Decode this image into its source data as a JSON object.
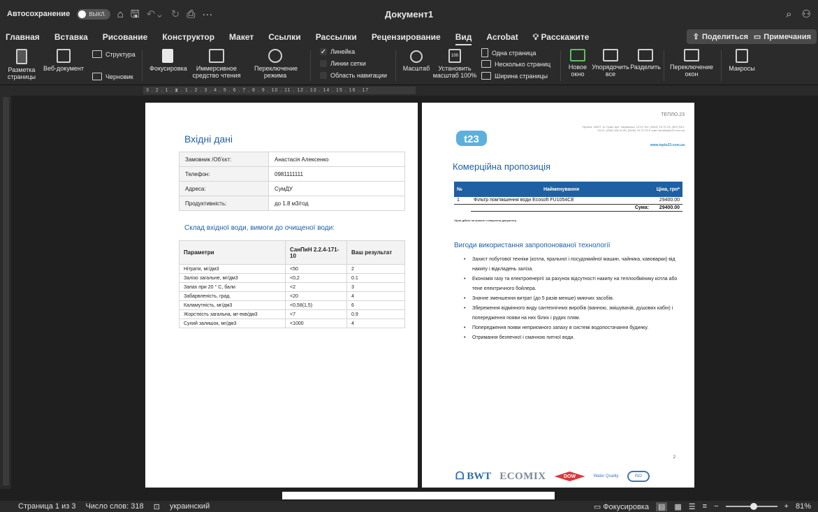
{
  "window": {
    "autosave_label": "Автосохранение",
    "autosave_state": "ВЫКЛ.",
    "doc_title": "Документ1"
  },
  "tabs": [
    "Главная",
    "Вставка",
    "Рисование",
    "Конструктор",
    "Макет",
    "Ссылки",
    "Рассылки",
    "Рецензирование",
    "Вид",
    "Acrobat"
  ],
  "active_tab": "Вид",
  "tell_me": "Расскажите",
  "share_label": "Поделиться",
  "comments_label": "Примечания",
  "ribbon": {
    "print_layout": "Разметка страницы",
    "web_layout": "Веб-документ",
    "outline": "Структура",
    "draft": "Черновик",
    "focus": "Фокусировка",
    "immersive": "Иммерсивное средство чтения",
    "switch_mode": "Переключение режима",
    "ruler": "Линейка",
    "gridlines": "Линии сетки",
    "nav_pane": "Область навигации",
    "zoom": "Масштаб",
    "zoom100": "Установить масштаб 100%",
    "one_page": "Одна страница",
    "multi_page": "Несколько страниц",
    "page_width": "Ширина страницы",
    "new_window": "Новое окно",
    "arrange_all": "Упорядочить все",
    "split": "Разделить",
    "switch_windows": "Переключение окон",
    "macros": "Макросы",
    "zoom100_badge": "100"
  },
  "ruler_text": "3 . 2 . 1 . ⧗ . 1 . 2 . 3 . 4 . 5 . 6 . 7 . 8 . 9 . 10 . 11 . 12 . 13 . 14 . 15 . 16 . 17",
  "page1": {
    "title": "Вхідні дані",
    "info": [
      {
        "k": "Замовник /Об'єкт:",
        "v": "Анастасія Алексенко"
      },
      {
        "k": "Телефон:",
        "v": "0981111111"
      },
      {
        "k": "Адреса:",
        "v": "СумДУ"
      },
      {
        "k": "Продуктивність:",
        "v": "до 1.8 м3/год"
      }
    ],
    "subtitle": "Склад вхідної води, вимоги до очищеної води:",
    "params_header": [
      "Параметри",
      "СанПиН 2.2.4-171-10",
      "Ваш результат"
    ],
    "params": [
      [
        "Нітрати, мг/дм3",
        "<50",
        "2"
      ],
      [
        "Залізо загальне, мг/дм3",
        "<0,2",
        "0.1"
      ],
      [
        "Запах при 20 ° С, бали",
        "<2",
        "3"
      ],
      [
        "Забарвленість, град.",
        "<20",
        "4"
      ],
      [
        "Каламутність, мг/дм3",
        "<0,58(1,5)",
        "6"
      ],
      [
        "Жорсткість загальна, мг-екв/дм3",
        "<7",
        "0.9"
      ],
      [
        "Сухий залишок, мг/дм3",
        "<1000",
        "4"
      ]
    ]
  },
  "page2": {
    "firm": "ТЕПЛО.23",
    "logo_text": "t23",
    "address": "Україна, 40007, м. Суми, вул. Харківська, 107/1 Тел. (0542) 76-70-76, (067) 543-34-01, (098) 248-12-55, (0542) 76-70-75 E-mail: info@teplo23.com.ua",
    "website": "www.teplo23.com.ua",
    "title": "Комерційна пропозиція",
    "offer_header": [
      "№",
      "Найменування",
      "Ціна, грн*"
    ],
    "offer_item": {
      "n": "1",
      "name": "Фільтр пом'якшення води Ecosoft FU1054CE",
      "price": "29400.00"
    },
    "sum_label": "Сума:",
    "sum_value": "29400.00",
    "note": "*Ціни дійсні на момент створення документу",
    "benefits_title": "Вигоди використання запропонованої технології",
    "benefits": [
      "Захист побутової техніки (котла, пральної і посудомийної машин, чайника, кавоварки) від накипу і відкладень заліза.",
      "Економія газу та електроенергії за рахунок відсутності накипу на теплообмінику котла або тене електричного бойлера.",
      "Значне зменшення витрат (до 5 разів менше) миючих засобів.",
      "Збереження відмінного виду сантехнічних виробів (ванною, змішувачів, душових кабін) і попередження появи на них білих і рудих плям.",
      "Попередження появи неприємного запаху в системі водопостачання будинку.",
      "Отримання безпечної і смачною питної води."
    ],
    "page_number": "2",
    "brands": {
      "bwt": "BWT",
      "ecomix": "ECOMIX",
      "dow": "DOW",
      "wq": "Water Quality",
      "iso": "ISO"
    }
  },
  "status": {
    "page": "Страница 1 из 3",
    "words": "Число слов: 318",
    "lang": "украинский",
    "focus": "Фокусировка",
    "zoom": "81%",
    "zoom_level": 0.55
  }
}
